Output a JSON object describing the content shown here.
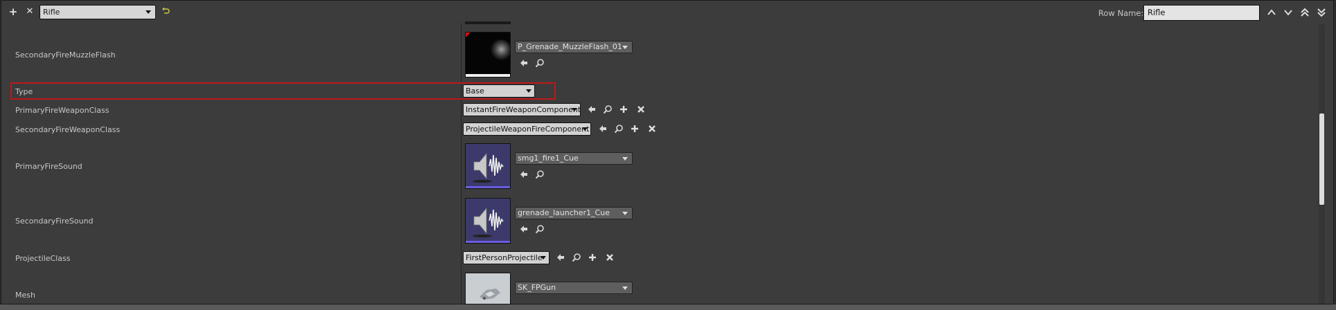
{
  "toolbar": {
    "add_label": "+",
    "delete_label": "✕",
    "row_selector_value": "Rifle",
    "reset_icon": "undo-icon",
    "row_name_label": "Row Name:",
    "row_name_value": "Rifle",
    "nav_icons": [
      "move-up-icon",
      "move-down-icon",
      "move-top-icon",
      "move-bottom-icon"
    ]
  },
  "properties": {
    "secondary_fire_muzzle_flash": {
      "name": "SecondaryFireMuzzleFlash",
      "value": "P_Grenade_MuzzleFlash_01"
    },
    "type": {
      "name": "Type",
      "value": "Base"
    },
    "primary_fire_weapon_class": {
      "name": "PrimaryFireWeaponClass",
      "value": "InstantFireWeaponComponent"
    },
    "secondary_fire_weapon_class": {
      "name": "SecondaryFireWeaponClass",
      "value": "ProjectileWeaponFireComponent"
    },
    "primary_fire_sound": {
      "name": "PrimaryFireSound",
      "value": "smg1_fire1_Cue"
    },
    "secondary_fire_sound": {
      "name": "SecondaryFireSound",
      "value": "grenade_launcher1_Cue"
    },
    "projectile_class": {
      "name": "ProjectileClass",
      "value": "FirstPersonProjectile"
    },
    "mesh": {
      "name": "Mesh",
      "value": "SK_FPGun"
    }
  },
  "colors": {
    "highlight": "#c01818",
    "panel": "#3c3c3c",
    "sound_thumb": "#3b3a6b"
  }
}
